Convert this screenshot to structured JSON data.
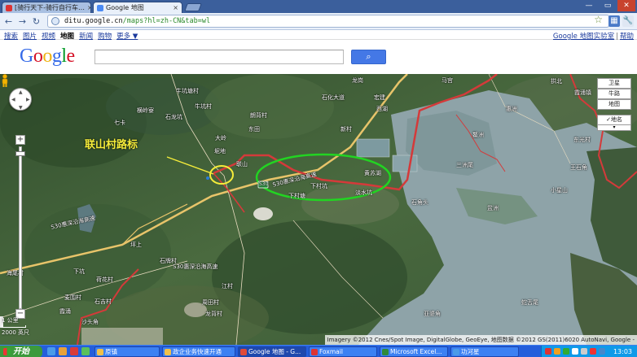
{
  "browser": {
    "tabs": [
      {
        "title": "[骑行天下-骑行自行车…",
        "active": false
      },
      {
        "title": "Google 地图",
        "active": true
      }
    ],
    "url_host": "ditu.google.cn",
    "url_path": "/maps?hl=zh-CN&tab=wl"
  },
  "gbar": {
    "links": [
      "搜索",
      "图片",
      "视频",
      "地图",
      "新闻",
      "购物",
      "更多 ▼"
    ],
    "current": "地图",
    "right_links": [
      "Google 地图实验室",
      "帮助"
    ]
  },
  "header": {
    "logo": "Google",
    "search_value": "",
    "search_button_icon": "magnifier-icon"
  },
  "map": {
    "annotation_text": "联山村路标",
    "highway_shield": "S30",
    "highway_name": "S30惠深沿海高速",
    "map_type_options": [
      "地图",
      "卫星",
      "地图"
    ],
    "map_type_satellite": "卫星",
    "map_type_sub": "牛路",
    "map_type_map": "地图",
    "map_type_labels_checked": true,
    "map_type_labels": "地名",
    "scale_top": "1 公里",
    "scale_bottom": "2000 英尺",
    "attribution": "Imagery ©2012 Cnes/Spot Image, DigitalGlobe, GeoEye, 地图数据 ©2012 GS(2011)6020 AutoNavi, Google -",
    "place_labels": [
      "牛坑塘村",
      "牛坑村",
      "石龙坑",
      "七卡",
      "横岭寮",
      "大岭",
      "东田",
      "朗背村",
      "坭地",
      "宏建",
      "新村",
      "龙岗",
      "联山",
      "下村坑",
      "黄苏湖",
      "淡水坑",
      "下村塘",
      "石角头",
      "三洲尾",
      "鳌洲",
      "盆洲",
      "惠洲",
      "小星山",
      "石牌村",
      "坪上",
      "下坑",
      "荷花村",
      "江村",
      "海尾村",
      "石吉村",
      "霞涌",
      "蛇舌尾",
      "周田村",
      "麦围村",
      "龙背村",
      "亚婆角",
      "沙头角",
      "马宫",
      "西湖",
      "拱北",
      "王石角",
      "东光村",
      "霞涌镇",
      "石化大道"
    ]
  },
  "taskbar": {
    "start_label": "开始",
    "tasks": [
      {
        "label": "原镇",
        "active": false
      },
      {
        "label": "政企业务快速开通",
        "active": false
      },
      {
        "label": "Google 地图 - G...",
        "active": true
      },
      {
        "label": "Foxmail",
        "active": false
      },
      {
        "label": "Microsoft Excel...",
        "active": false
      },
      {
        "label": "功河星",
        "active": false
      }
    ],
    "clock": "13:03"
  },
  "colors": {
    "route_red": "#d43a3a",
    "highway_yellow": "#e8c46a",
    "circle_yellow": "#f5ec3a",
    "circle_green": "#22d422",
    "water": "#8ea3a8",
    "land_dark": "#3a5532"
  }
}
